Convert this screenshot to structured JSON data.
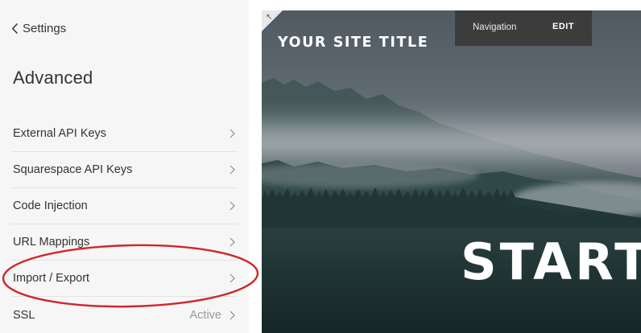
{
  "sidebar": {
    "back_label": "Settings",
    "title": "Advanced",
    "items": [
      {
        "label": "External API Keys",
        "status": ""
      },
      {
        "label": "Squarespace API Keys",
        "status": ""
      },
      {
        "label": "Code Injection",
        "status": ""
      },
      {
        "label": "URL Mappings",
        "status": ""
      },
      {
        "label": "Import / Export",
        "status": ""
      },
      {
        "label": "SSL",
        "status": "Active"
      }
    ]
  },
  "preview": {
    "site_title": "YOUR SITE TITLE",
    "nav_label": "Navigation",
    "edit_label": "EDIT",
    "hero_text": "START"
  },
  "icons": {
    "back": "chevron-left-icon",
    "item_arrow": "chevron-right-icon",
    "corner": "expand-arrow-icon"
  },
  "colors": {
    "sidebar_bg": "#f6f6f6",
    "annotation": "#d0262c",
    "nav_bar_bg": "#3c3c3c"
  }
}
